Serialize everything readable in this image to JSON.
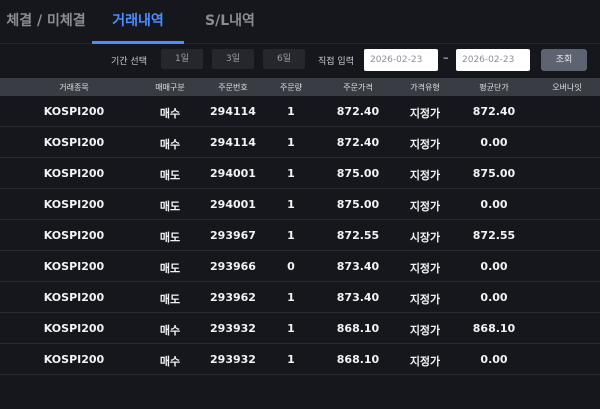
{
  "tabs": [
    {
      "label": "체결 / 미체결"
    },
    {
      "label": "거래내역"
    },
    {
      "label": "S/L내역"
    }
  ],
  "filter": {
    "period_label": "기간 선택",
    "periods": [
      "1일",
      "3일",
      "6일"
    ],
    "direct_label": "직접 입력",
    "start_date": "2026-02-23",
    "separator": "–",
    "end_date": "2026-02-23",
    "search_label": "조회"
  },
  "table": {
    "headers": [
      "거래종목",
      "매매구분",
      "주문번호",
      "주문량",
      "주문가격",
      "가격유형",
      "평균단가",
      "오버나잇"
    ],
    "rows": [
      [
        "KOSPI200",
        "매수",
        "294114",
        "1",
        "872.40",
        "지정가",
        "872.40",
        ""
      ],
      [
        "KOSPI200",
        "매수",
        "294114",
        "1",
        "872.40",
        "지정가",
        "0.00",
        ""
      ],
      [
        "KOSPI200",
        "매도",
        "294001",
        "1",
        "875.00",
        "지정가",
        "875.00",
        ""
      ],
      [
        "KOSPI200",
        "매도",
        "294001",
        "1",
        "875.00",
        "지정가",
        "0.00",
        ""
      ],
      [
        "KOSPI200",
        "매도",
        "293967",
        "1",
        "872.55",
        "시장가",
        "872.55",
        ""
      ],
      [
        "KOSPI200",
        "매도",
        "293966",
        "0",
        "873.40",
        "지정가",
        "0.00",
        ""
      ],
      [
        "KOSPI200",
        "매도",
        "293962",
        "1",
        "873.40",
        "지정가",
        "0.00",
        ""
      ],
      [
        "KOSPI200",
        "매수",
        "293932",
        "1",
        "868.10",
        "지정가",
        "868.10",
        ""
      ],
      [
        "KOSPI200",
        "매수",
        "293932",
        "1",
        "868.10",
        "지정가",
        "0.00",
        ""
      ]
    ]
  },
  "colors": {
    "background": "#16171c",
    "accent": "#4c8dff",
    "header_bg": "#3a3c44"
  }
}
